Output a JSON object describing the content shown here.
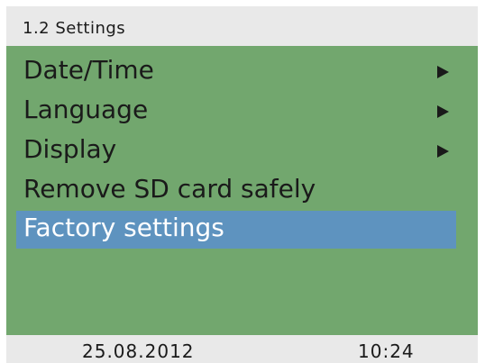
{
  "colors": {
    "header_background": "#e9e9e9",
    "menu_background": "#72a76e",
    "selected_background": "#5e93bf",
    "selected_text": "#ffffff",
    "text": "#1a1a1a"
  },
  "header": {
    "title": "1.2 Settings"
  },
  "menu": {
    "items": [
      {
        "label": "Date/Time",
        "icon": "submenu-arrow-icon",
        "has_submenu": true,
        "selected": false
      },
      {
        "label": "Language",
        "icon": "submenu-arrow-icon",
        "has_submenu": true,
        "selected": false
      },
      {
        "label": "Display",
        "icon": "submenu-arrow-icon",
        "has_submenu": true,
        "selected": false
      },
      {
        "label": "Remove SD card safely",
        "has_submenu": false,
        "selected": false
      },
      {
        "label": "Factory settings",
        "has_submenu": false,
        "selected": true
      }
    ]
  },
  "footer": {
    "date": "25.08.2012",
    "time": "10:24"
  }
}
